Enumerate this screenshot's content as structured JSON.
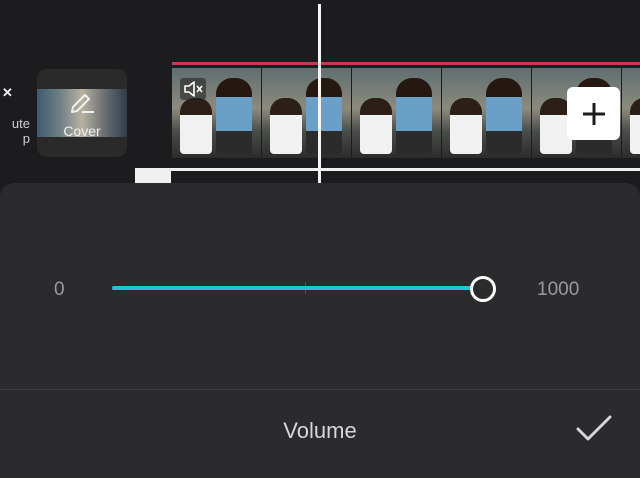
{
  "timeline": {
    "mute_clip_label_line1": "ute",
    "mute_clip_label_line2": "p",
    "mute_clip_icon": "x-mark-icon",
    "cover_label": "Cover",
    "cover_icon": "pencil-icon",
    "clip_mute_icon": "speaker-muted-icon",
    "add_icon": "plus-icon",
    "frame_count": 6
  },
  "volume": {
    "min_label": "0",
    "max_label": "1000",
    "value": 1000,
    "min": 0,
    "max": 1000,
    "accent_color": "#1fc5d3"
  },
  "panel": {
    "title": "Volume",
    "confirm_icon": "checkmark-icon"
  },
  "colors": {
    "background": "#1c1c1e",
    "panel": "#2b2b2d",
    "clip_marker": "#c23a55"
  }
}
